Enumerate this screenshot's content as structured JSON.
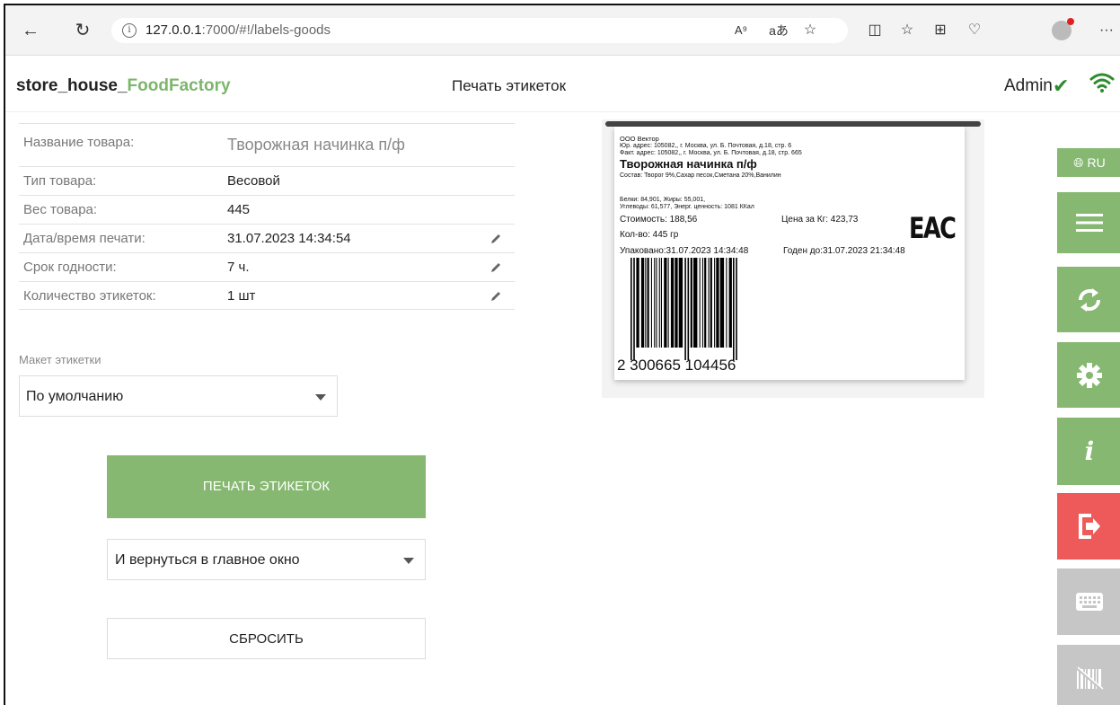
{
  "browser": {
    "url_host": "127.0.0.1",
    "url_path": ":7000/#!/labels-goods",
    "more": "···"
  },
  "header": {
    "brand_main": "store_house_",
    "brand_accent": "FoodFactory",
    "page_title": "Печать этикеток",
    "user": "Admin"
  },
  "form": {
    "rows": [
      {
        "label": "Название товара:",
        "value": "Творожная начинка п/ф",
        "editable": false
      },
      {
        "label": "Тип товара:",
        "value": "Весовой",
        "editable": false
      },
      {
        "label": "Вес товара:",
        "value": "445",
        "editable": false
      },
      {
        "label": "Дата/время печати:",
        "value": "31.07.2023 14:34:54",
        "editable": true
      },
      {
        "label": "Срок годности:",
        "value": "7 ч.",
        "editable": true
      },
      {
        "label": "Количество этикеток:",
        "value": "1 шт",
        "editable": true
      }
    ],
    "layout_label": "Макет этикетки",
    "layout_value": "По умолчанию",
    "print_button": "ПЕЧАТЬ ЭТИКЕТОК",
    "after_print_value": "И вернуться в главное окно",
    "reset_button": "СБРОСИТЬ"
  },
  "label_preview": {
    "company": "ООО Вектор",
    "legal_address": "Юр. адрес: 105082,, г. Москва, ул. Б. Почтовая, д.18, стр. 6",
    "actual_address": "Факт. адрес: 105082,, г. Москва, ул. Б. Почтовая, д.18, стр. 665",
    "product_name": "Творожная начинка п/ф",
    "composition": "Состав: Творог 9%,Сахар песок,Сметана 20%,Ванилин",
    "nutrition_1": "Белки: 84,901, Жиры: 55,001,",
    "nutrition_2": "Углеводы: 61,577, Энерг. ценность: 1081 ККал",
    "cost": "Стоимость: 188,56",
    "price_per_kg": "Цена за Кг: 423,73",
    "quantity": "Кол-во: 445 гр",
    "packed": "Упаковано:31.07.2023 14:34:48",
    "valid_until": "Годен до:31.07.2023 21:34:48",
    "eac_mark": "EAC",
    "barcode_digits": "2 300665 104456"
  },
  "rail": {
    "lang": "RU",
    "icons": [
      "menu-icon",
      "sync-icon",
      "settings-icon",
      "info-icon",
      "logout-icon",
      "keyboard-icon",
      "barcode-off-icon"
    ]
  },
  "colors": {
    "accent_green": "#86b872",
    "logout_red": "#ee5a5a",
    "disabled_gray": "#c6c6c6",
    "status_green": "#2e8b2e"
  }
}
